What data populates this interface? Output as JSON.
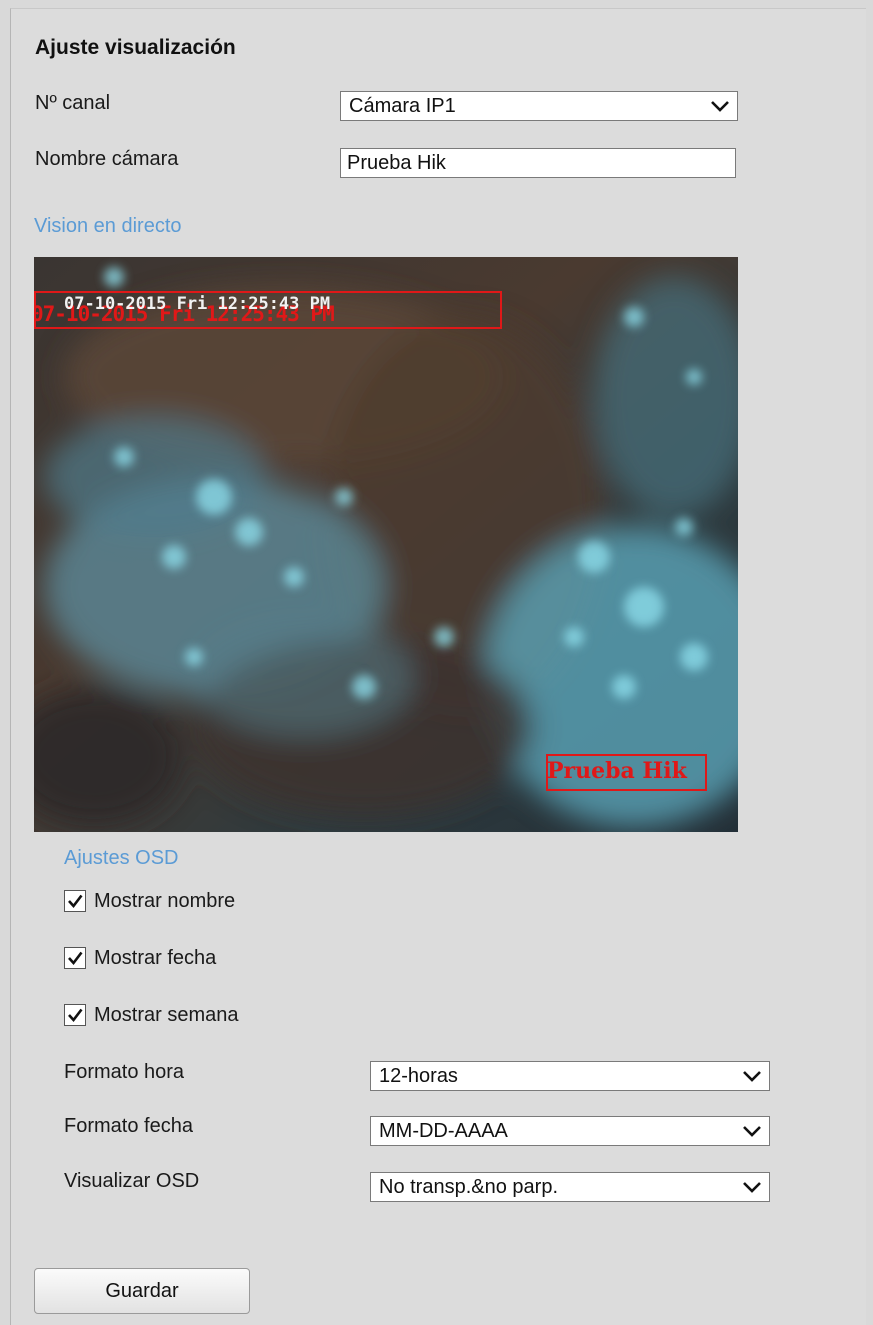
{
  "section": {
    "title": "Ajuste visualización"
  },
  "channel": {
    "label": "Nº canal",
    "value": "Cámara IP1"
  },
  "camera_name": {
    "label": "Nombre cámara",
    "value": "Prueba Hik"
  },
  "live_view": {
    "title": "Vision en directo",
    "osd_datetime": "07-10-2015 Fri 12:25:43 PM",
    "osd_name": "Prueba Hik"
  },
  "osd": {
    "title": "Ajustes OSD",
    "show_name": {
      "label": "Mostrar nombre",
      "checked": true
    },
    "show_date": {
      "label": "Mostrar fecha",
      "checked": true
    },
    "show_week": {
      "label": "Mostrar semana",
      "checked": true
    },
    "time_format": {
      "label": "Formato hora",
      "value": "12-horas"
    },
    "date_format": {
      "label": "Formato fecha",
      "value": "MM-DD-AAAA"
    },
    "display_mode": {
      "label": "Visualizar OSD",
      "value": "No transp.&no parp."
    }
  },
  "actions": {
    "save_label": "Guardar"
  },
  "colors": {
    "accent_link": "#5b9bd5",
    "osd_red": "#e01818"
  }
}
